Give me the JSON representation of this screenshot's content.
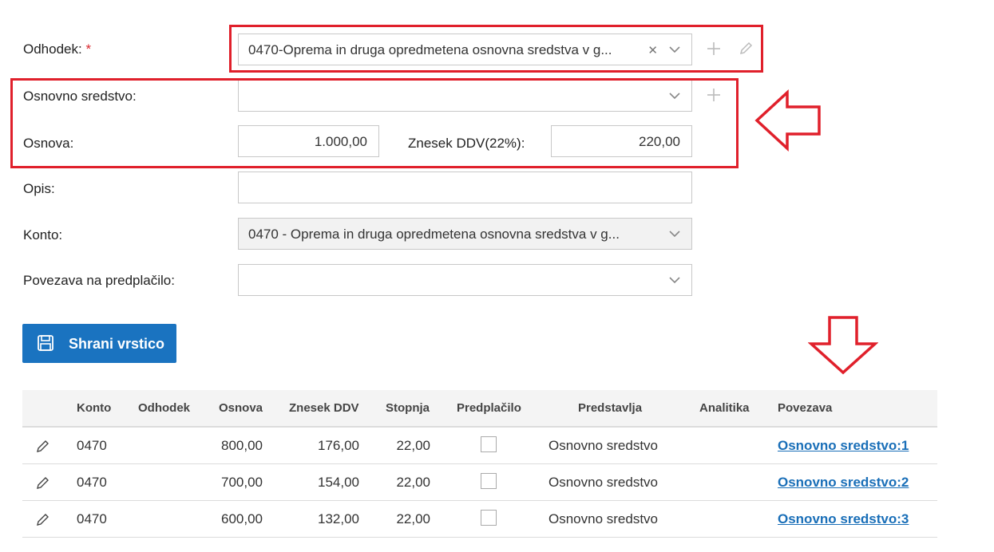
{
  "form": {
    "odhodek_label": "Odhodek:",
    "required_mark": "*",
    "odhodek_value": "0470-Oprema in druga opredmetena osnovna sredstva v g...",
    "osnovno_label": "Osnovno sredstvo:",
    "osnovno_value": "",
    "osnova_label": "Osnova:",
    "osnova_value": "1.000,00",
    "ddv_label": "Znesek DDV(22%):",
    "ddv_value": "220,00",
    "opis_label": "Opis:",
    "opis_value": "",
    "konto_label": "Konto:",
    "konto_value": "0470 - Oprema in druga opredmetena osnovna sredstva v g...",
    "povezava_label": "Povezava na predplačilo:",
    "povezava_value": ""
  },
  "save_button": {
    "label": "Shrani vrstico"
  },
  "table": {
    "headers": {
      "konto": "Konto",
      "odhodek": "Odhodek",
      "osnova": "Osnova",
      "ddv": "Znesek DDV",
      "stopnja": "Stopnja",
      "predplacilo": "Predplačilo",
      "predstavlja": "Predstavlja",
      "analitika": "Analitika",
      "povezava": "Povezava"
    },
    "rows": [
      {
        "konto": "0470",
        "odhodek": "",
        "osnova": "800,00",
        "ddv": "176,00",
        "stopnja": "22,00",
        "predstavlja": "Osnovno sredstvo",
        "analitika": "",
        "povezava": "Osnovno sredstvo:1"
      },
      {
        "konto": "0470",
        "odhodek": "",
        "osnova": "700,00",
        "ddv": "154,00",
        "stopnja": "22,00",
        "predstavlja": "Osnovno sredstvo",
        "analitika": "",
        "povezava": "Osnovno sredstvo:2"
      },
      {
        "konto": "0470",
        "odhodek": "",
        "osnova": "600,00",
        "ddv": "132,00",
        "stopnja": "22,00",
        "predstavlja": "Osnovno sredstvo",
        "analitika": "",
        "povezava": "Osnovno sredstvo:3"
      }
    ]
  },
  "colors": {
    "accent": "#1a73c0",
    "annotation_red": "#e0202b",
    "link": "#1a6fb8"
  }
}
